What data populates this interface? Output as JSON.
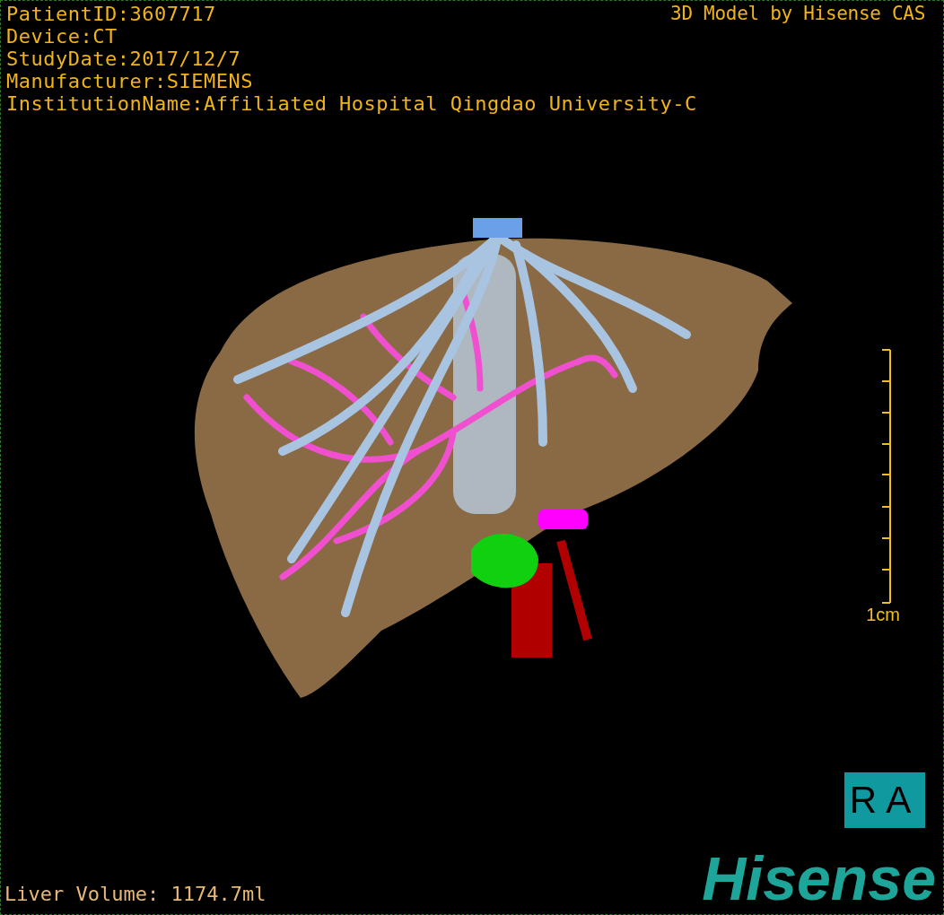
{
  "study_info": [
    "PatientID:3607717",
    "Device:CT",
    "StudyDate:2017/12/7",
    "Manufacturer:SIEMENS",
    "InstitutionName:Affiliated Hospital Qingdao University-C"
  ],
  "credit": "3D Model by Hisense CAS",
  "scale_bar": {
    "label": "1cm"
  },
  "liver_volume": "Liver Volume: 1174.7ml",
  "orientation_marker": "RA",
  "logo": "Hisense"
}
